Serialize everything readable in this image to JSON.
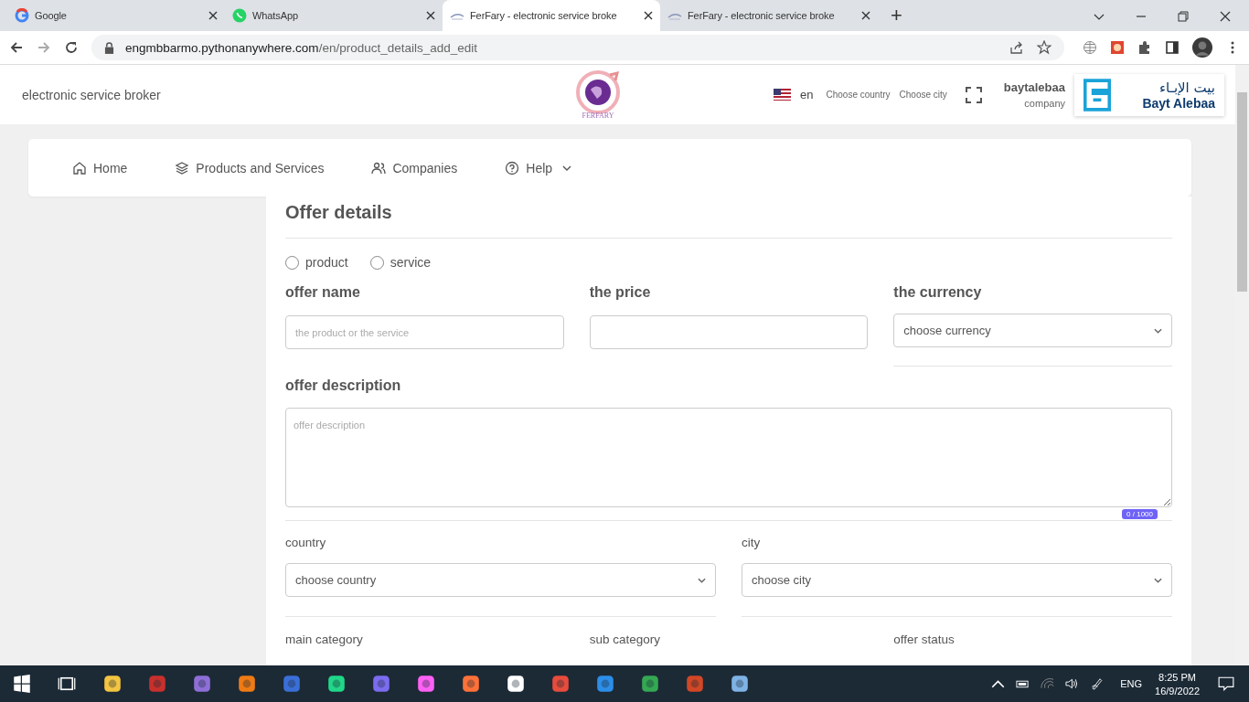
{
  "browser": {
    "tabs": [
      {
        "title": "Google",
        "kind": "google",
        "selected": false
      },
      {
        "title": "WhatsApp",
        "kind": "whatsapp",
        "selected": false
      },
      {
        "title": "FerFary - electronic service broke",
        "kind": "ferfary",
        "selected": true
      },
      {
        "title": "FerFary - electronic service broke",
        "kind": "ferfary",
        "selected": false
      }
    ],
    "new_tab": "+",
    "address_host": "engmbbarmo.pythonanywhere.com",
    "address_path": "/en/product_details_add_edit"
  },
  "header": {
    "tagline": "electronic service broker",
    "logo_text": "FERFARY",
    "language": "en",
    "choose_country": "Choose country",
    "choose_city": "Choose city",
    "user_name": "baytalebaa",
    "user_role": "company",
    "brand_arabic": "بيت الإبـاء",
    "brand_latin": "Bayt Alebaa"
  },
  "nav": [
    {
      "label": "Home",
      "kind": "home",
      "dropdown": false
    },
    {
      "label": "Products and Services",
      "kind": "layers",
      "dropdown": false
    },
    {
      "label": "Companies",
      "kind": "users",
      "dropdown": false
    },
    {
      "label": "Help",
      "kind": "help",
      "dropdown": true
    }
  ],
  "form": {
    "title": "Offer details",
    "offer_types": [
      {
        "label": "product",
        "selected": false
      },
      {
        "label": "service",
        "selected": false
      }
    ],
    "offer_name": {
      "label": "offer name",
      "placeholder": "the product or the service"
    },
    "price": {
      "label": "the price"
    },
    "currency": {
      "label": "the currency",
      "value": "choose currency"
    },
    "description": {
      "label": "offer description",
      "placeholder": "offer description",
      "counter": "0 / 1000"
    },
    "country": {
      "label": "country",
      "value": "choose country"
    },
    "city": {
      "label": "city",
      "value": "choose city"
    },
    "bottom_labels": [
      "main category",
      "sub category",
      "offer status"
    ]
  },
  "taskbar": {
    "language": "ENG",
    "time": "8:25 PM",
    "date": "16/9/2022"
  }
}
